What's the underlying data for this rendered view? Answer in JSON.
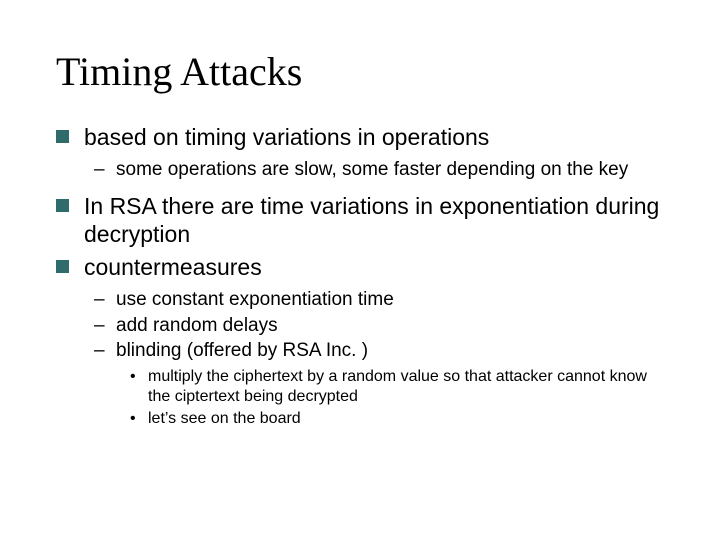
{
  "title": "Timing Attacks",
  "bullets": [
    {
      "text": "based on timing variations in operations",
      "children": [
        {
          "text": "some operations are slow, some faster depending on the key"
        }
      ]
    },
    {
      "text": "In RSA there are time variations in exponentiation during decryption"
    },
    {
      "text": "countermeasures",
      "children": [
        {
          "text": "use constant exponentiation time"
        },
        {
          "text": "add random delays"
        },
        {
          "text": "blinding (offered by RSA Inc. )",
          "children": [
            {
              "text": "multiply the ciphertext by a random value so that attacker cannot know the ciptertext being decrypted"
            },
            {
              "text": "let’s see on the board"
            }
          ]
        }
      ]
    }
  ],
  "colors": {
    "bullet_square": "#2f6b6b"
  }
}
